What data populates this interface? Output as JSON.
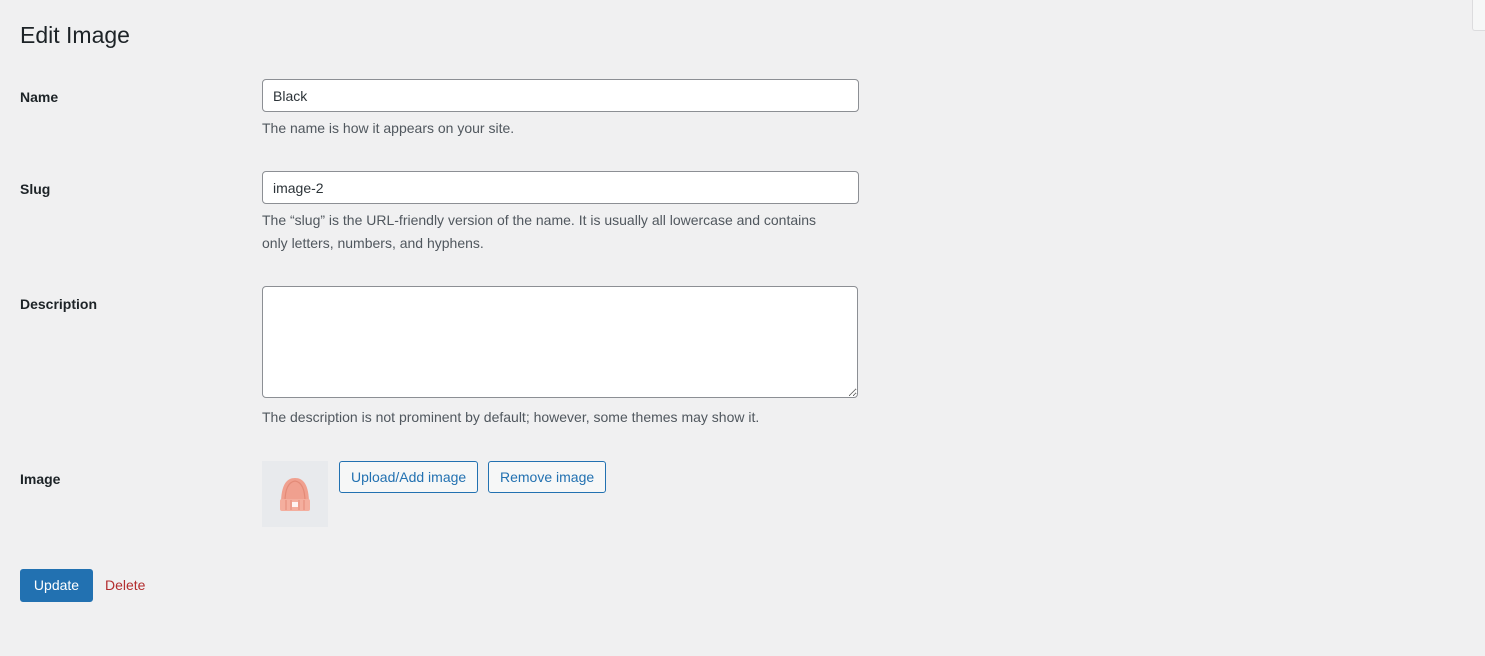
{
  "page": {
    "title": "Edit Image"
  },
  "fields": {
    "name": {
      "label": "Name",
      "value": "Black",
      "description": "The name is how it appears on your site."
    },
    "slug": {
      "label": "Slug",
      "value": "image-2",
      "description": "The “slug” is the URL-friendly version of the name. It is usually all lowercase and contains only letters, numbers, and hyphens."
    },
    "description": {
      "label": "Description",
      "value": "",
      "description": "The description is not prominent by default; however, some themes may show it."
    },
    "image": {
      "label": "Image",
      "thumbnail_icon": "beanie-hat-thumbnail",
      "upload_label": "Upload/Add image",
      "remove_label": "Remove image"
    }
  },
  "actions": {
    "update_label": "Update",
    "delete_label": "Delete"
  },
  "colors": {
    "background": "#f0f0f1",
    "primary": "#2271b1",
    "delete": "#b32d2e",
    "hat": "#f0a08f"
  }
}
